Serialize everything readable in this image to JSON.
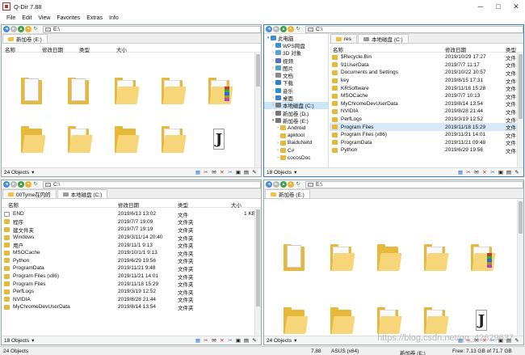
{
  "window": {
    "title": "Q-Dir 7.88"
  },
  "menu": [
    "File",
    "Edit",
    "View",
    "Favorites",
    "Extras",
    "Info"
  ],
  "panes": {
    "tl": {
      "path": "E:\\",
      "tabs": [
        "新加卷 (E:)"
      ],
      "headers": [
        "名称",
        "修改日期",
        "类型",
        "大小"
      ],
      "status": "24 Objects"
    },
    "tr": {
      "path": "C:\\",
      "tabs": [
        "res",
        "本地磁盘 (C:)"
      ],
      "headers": [
        "名称",
        "修改日期",
        "类型"
      ],
      "status": "18 Objects",
      "tree": [
        {
          "label": "此电脑",
          "color": "#3b8fd6",
          "arrow": "▾",
          "indent": 0
        },
        {
          "label": "WPS网盘",
          "color": "#3b8fd6",
          "arrow": "›",
          "indent": 1
        },
        {
          "label": "3D 对象",
          "color": "#5a9fd4",
          "arrow": "›",
          "indent": 1
        },
        {
          "label": "视频",
          "color": "#5a6fc4",
          "arrow": "›",
          "indent": 1
        },
        {
          "label": "图片",
          "color": "#4aa0c8",
          "arrow": "›",
          "indent": 1
        },
        {
          "label": "文档",
          "color": "#8a8a8a",
          "arrow": "›",
          "indent": 1
        },
        {
          "label": "下载",
          "color": "#2a7fd0",
          "arrow": "›",
          "indent": 1
        },
        {
          "label": "音乐",
          "color": "#2a8fd0",
          "arrow": "›",
          "indent": 1
        },
        {
          "label": "桌面",
          "color": "#3a7fd0",
          "arrow": "›",
          "indent": 1
        },
        {
          "label": "本地磁盘 (C:)",
          "color": "#777",
          "arrow": "›",
          "indent": 1,
          "selected": true
        },
        {
          "label": "新加卷 (D:)",
          "color": "#777",
          "arrow": "›",
          "indent": 1
        },
        {
          "label": "新加卷 (E:)",
          "color": "#777",
          "arrow": "▾",
          "indent": 1
        },
        {
          "label": "Android",
          "color": "#e6b93a",
          "arrow": "›",
          "indent": 2
        },
        {
          "label": "apktool",
          "color": "#e6b93a",
          "arrow": "",
          "indent": 2
        },
        {
          "label": "BaiduNetd",
          "color": "#e6b93a",
          "arrow": "›",
          "indent": 2
        },
        {
          "label": "C#",
          "color": "#e6b93a",
          "arrow": "›",
          "indent": 2
        },
        {
          "label": "cocosDoc",
          "color": "#e6b93a",
          "arrow": "›",
          "indent": 2
        }
      ],
      "rows": [
        {
          "name": "$Recycle.Bin",
          "date": "2019/10/29 17:27",
          "type": "文件"
        },
        {
          "name": "91UserData",
          "date": "2019/7/7 11:17",
          "type": "文件"
        },
        {
          "name": "Documents and Settings",
          "date": "2019/10/22 10:57",
          "type": "文件"
        },
        {
          "name": "key",
          "date": "2019/8/15 17:31",
          "type": "文件"
        },
        {
          "name": "KRSoftware",
          "date": "2019/11/18 15:28",
          "type": "文件"
        },
        {
          "name": "MSOCache",
          "date": "2019/7/7 10:13",
          "type": "文件"
        },
        {
          "name": "MyChromeDevUserData",
          "date": "2019/8/14 13:54",
          "type": "文件"
        },
        {
          "name": "NVIDIA",
          "date": "2019/8/28 21:44",
          "type": "文件"
        },
        {
          "name": "PerfLogs",
          "date": "2019/3/19 12:52",
          "type": "文件"
        },
        {
          "name": "Program Files",
          "date": "2019/11/18 15:29",
          "type": "文件",
          "hl": true
        },
        {
          "name": "Program Files (x86)",
          "date": "2019/11/21 14:01",
          "type": "文件"
        },
        {
          "name": "ProgramData",
          "date": "2019/11/21 09:48",
          "type": "文件"
        },
        {
          "name": "Python",
          "date": "2019/6/29 19:56",
          "type": "文件"
        }
      ]
    },
    "bl": {
      "path": "C:\\",
      "tabs": [
        "00Tyme在内的",
        "本地磁盘 (C:)"
      ],
      "headers": [
        "名称",
        "修改日期",
        "类型",
        "大小"
      ],
      "status": "18 Objects",
      "rows": [
        {
          "name": "END",
          "date": "2019/6/13 13:02",
          "type": "文件",
          "size": "1 KB",
          "icon": "file"
        },
        {
          "name": "程序",
          "date": "2019/7/7 19:09",
          "type": "文件夹",
          "size": "",
          "icon": "folder"
        },
        {
          "name": "建文件夹",
          "date": "2019/7/7 19:19",
          "type": "文件夹",
          "size": "",
          "icon": "folder"
        },
        {
          "name": "Windows",
          "date": "2019/3/11/14 20:40",
          "type": "文件夹",
          "size": "",
          "icon": "folder"
        },
        {
          "name": "用户",
          "date": "2019/11/1 9:13",
          "type": "文件夹",
          "size": "",
          "icon": "folder"
        },
        {
          "name": "MSOCache",
          "date": "2019/10/1/1 9:13",
          "type": "文件夹",
          "size": "",
          "icon": "folder"
        },
        {
          "name": "Python",
          "date": "2019/6/29 19:56",
          "type": "文件夹",
          "size": "",
          "icon": "folder"
        },
        {
          "name": "ProgramData",
          "date": "2019/11/21 9:48",
          "type": "文件夹",
          "size": "",
          "icon": "folder"
        },
        {
          "name": "Program Files (x86)",
          "date": "2019/11/21 14:01",
          "type": "文件夹",
          "size": "",
          "icon": "folder"
        },
        {
          "name": "Program Files",
          "date": "2019/11/18 15:29",
          "type": "文件夹",
          "size": "",
          "icon": "folder"
        },
        {
          "name": "PerfLogs",
          "date": "2019/3/19 12:52",
          "type": "文件夹",
          "size": "",
          "icon": "folder"
        },
        {
          "name": "NVIDIA",
          "date": "2019/8/28 21:44",
          "type": "文件夹",
          "size": "",
          "icon": "folder"
        },
        {
          "name": "MyChromeDevUserData",
          "date": "2019/8/14 13:54",
          "type": "文件夹",
          "size": "",
          "icon": "folder"
        }
      ]
    },
    "br": {
      "path": "E:\\",
      "tabs": [
        "新加卷 (E:)"
      ],
      "status": "24 Objects"
    }
  },
  "bottom": {
    "objects": "24 Objects",
    "size": "7.88",
    "asus": "ASUS (x64)",
    "drive": "新加卷 (E:)",
    "free": "Free: 7.13 GB of 71.7 GB"
  },
  "watermark": "https://blog.csdn.net/qq_42629637"
}
